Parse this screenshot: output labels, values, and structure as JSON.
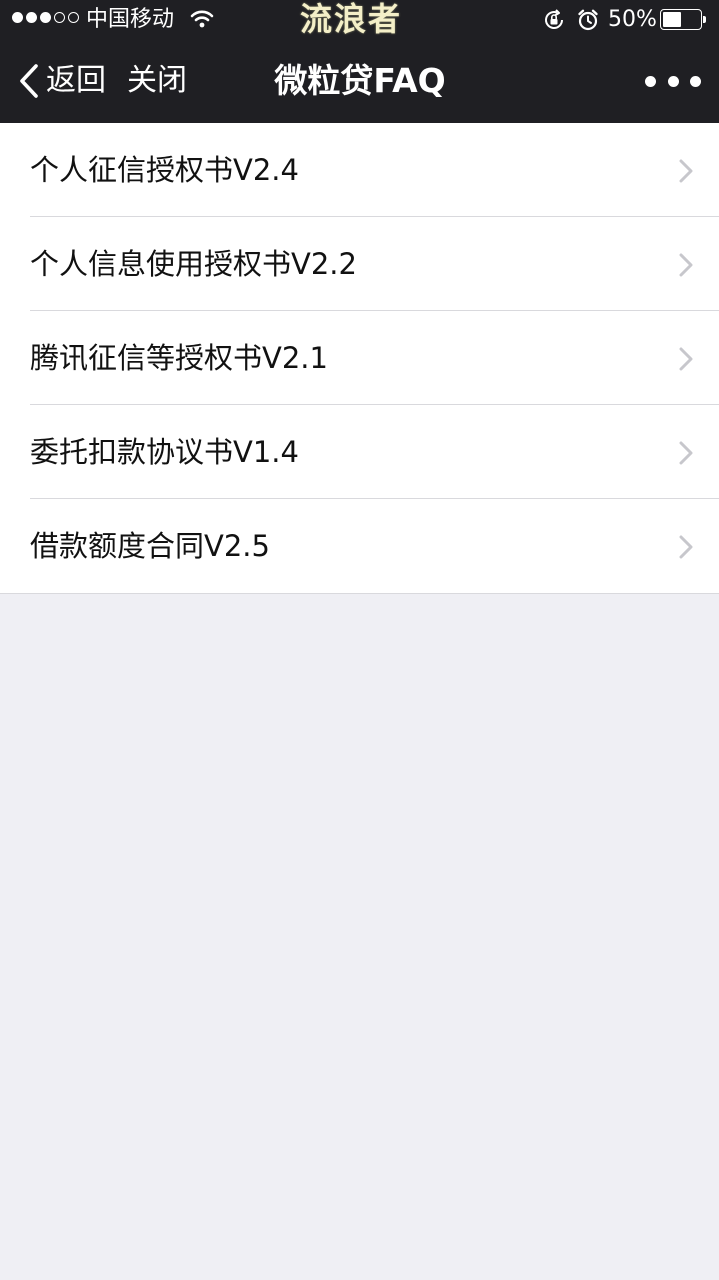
{
  "status_bar": {
    "signal_icon": "signal-dots-icon",
    "carrier": "中国移动",
    "wifi_icon": "wifi-icon",
    "watermark": "流浪者",
    "lock_icon": "orientation-lock-icon",
    "alarm_icon": "alarm-clock-icon",
    "battery_percent": "50%",
    "battery_level": 0.5
  },
  "nav": {
    "back_label": "返回",
    "close_label": "关闭",
    "title": "微粒贷FAQ",
    "more_icon": "more-dots-icon"
  },
  "list": {
    "items": [
      {
        "label": "个人征信授权书V2.4",
        "icon": "chevron-right-icon"
      },
      {
        "label": "个人信息使用授权书V2.2",
        "icon": "chevron-right-icon"
      },
      {
        "label": "腾讯征信等授权书V2.1",
        "icon": "chevron-right-icon"
      },
      {
        "label": "委托扣款协议书V1.4",
        "icon": "chevron-right-icon"
      },
      {
        "label": "借款额度合同V2.5",
        "icon": "chevron-right-icon"
      }
    ]
  },
  "colors": {
    "header_bg": "#1f1f23",
    "page_bg": "#efeff4",
    "list_bg": "#ffffff",
    "divider": "#d9d9dd",
    "chevron": "#c7c7cc"
  }
}
